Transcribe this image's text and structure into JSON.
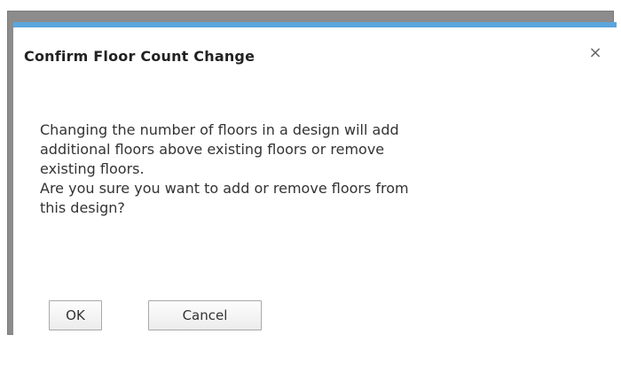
{
  "dialog": {
    "title": "Confirm Floor Count Change",
    "close_icon": "close-icon",
    "close_glyph": "×",
    "accent_color": "#5ba6dc",
    "message_lines": [
      "Changing the number of floors in a design will add",
      "additional floors above existing floors or remove",
      "existing floors.",
      "Are you sure you want to add or remove floors from",
      "this design?"
    ],
    "buttons": {
      "ok_label": "OK",
      "cancel_label": "Cancel"
    }
  }
}
